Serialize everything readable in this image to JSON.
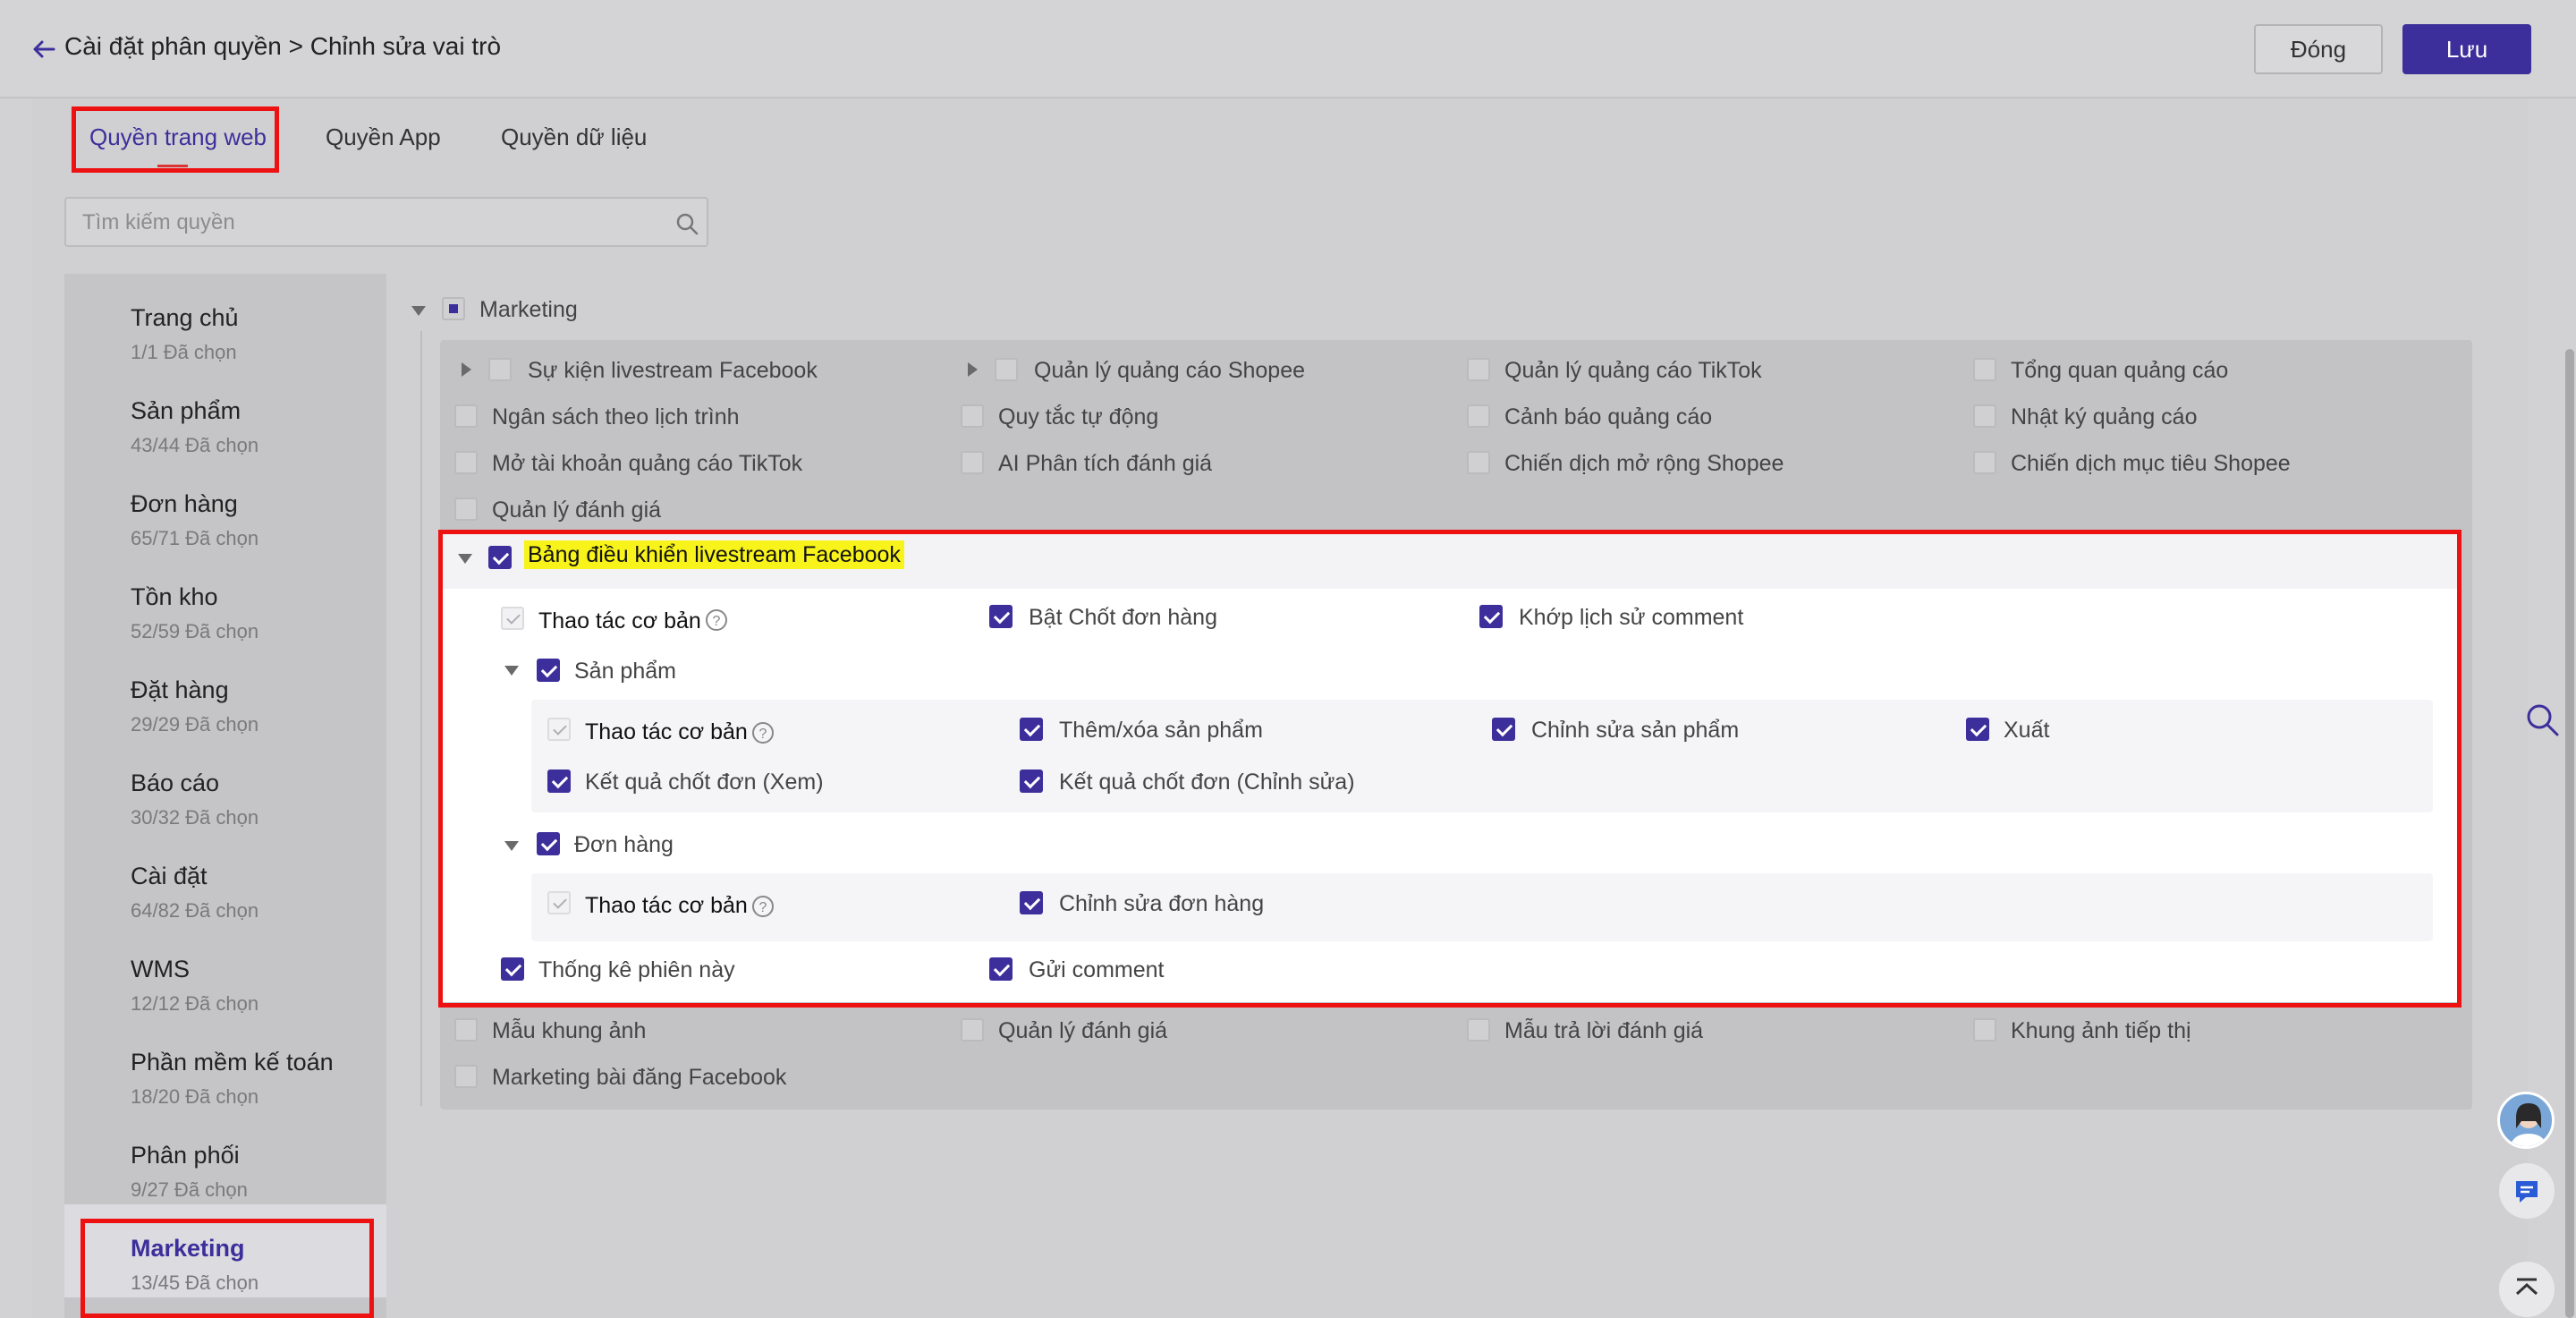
{
  "header": {
    "title": "Cài đặt phân quyền > Chỉnh sửa vai trò",
    "close_label": "Đóng",
    "save_label": "Lưu"
  },
  "tabs": [
    "Quyền trang web",
    "Quyền App",
    "Quyền dữ liệu"
  ],
  "search": {
    "placeholder": "Tìm kiếm quyền"
  },
  "sidebar": [
    {
      "label": "Trang chủ",
      "count": "1/1 Đã chọn"
    },
    {
      "label": "Sản phẩm",
      "count": "43/44 Đã chọn"
    },
    {
      "label": "Đơn hàng",
      "count": "65/71 Đã chọn"
    },
    {
      "label": "Tồn kho",
      "count": "52/59 Đã chọn"
    },
    {
      "label": "Đặt hàng",
      "count": "29/29 Đã chọn"
    },
    {
      "label": "Báo cáo",
      "count": "30/32 Đã chọn"
    },
    {
      "label": "Cài đặt",
      "count": "64/82 Đã chọn"
    },
    {
      "label": "WMS",
      "count": "12/12 Đã chọn"
    },
    {
      "label": "Phần mềm kế toán",
      "count": "18/20 Đã chọn"
    },
    {
      "label": "Phân phối",
      "count": "9/27 Đã chọn"
    },
    {
      "label": "Marketing",
      "count": "13/45 Đã chọn"
    }
  ],
  "tree": {
    "root": "Marketing",
    "items_top": [
      "Sự kiện livestream Facebook",
      "Quản lý quảng cáo Shopee",
      "Quản lý quảng cáo TikTok",
      "Tổng quan quảng cáo",
      "Ngân sách theo lịch trình",
      "Quy tắc tự động",
      "Cảnh báo quảng cáo",
      "Nhật ký quảng cáo",
      "Mở tài khoản quảng cáo TikTok",
      "AI Phân tích đánh giá",
      "Chiến dịch mở rộng Shopee",
      "Chiến dịch mục tiêu Shopee",
      "Quản lý đánh giá"
    ],
    "fb_dashboard": {
      "title": "Bảng điều khiển livestream Facebook",
      "basic": "Thao tác cơ bản",
      "bat_chot": "Bật Chốt đơn hàng",
      "khop": "Khớp lịch sử comment",
      "san_pham": {
        "title": "Sản phẩm",
        "basic": "Thao tác cơ bản",
        "them_xoa": "Thêm/xóa sản phẩm",
        "chinh_sua": "Chỉnh sửa sản phẩm",
        "xuat": "Xuất",
        "kq_xem": "Kết quả chốt đơn (Xem)",
        "kq_sua": "Kết quả chốt đơn (Chỉnh sửa)"
      },
      "don_hang": {
        "title": "Đơn hàng",
        "basic": "Thao tác cơ bản",
        "chinh_sua": "Chỉnh sửa đơn hàng"
      },
      "thong_ke": "Thống kê phiên này",
      "gui_comment": "Gửi comment"
    },
    "items_bottom": [
      "Mẫu khung ảnh",
      "Quản lý đánh giá",
      "Mẫu trả lời đánh giá",
      "Khung ảnh tiếp thị",
      "Marketing bài đăng Facebook"
    ]
  },
  "colors": {
    "accent": "#3d2f9b",
    "highlight": "#f8f31a",
    "annotation": "#ee1111"
  }
}
